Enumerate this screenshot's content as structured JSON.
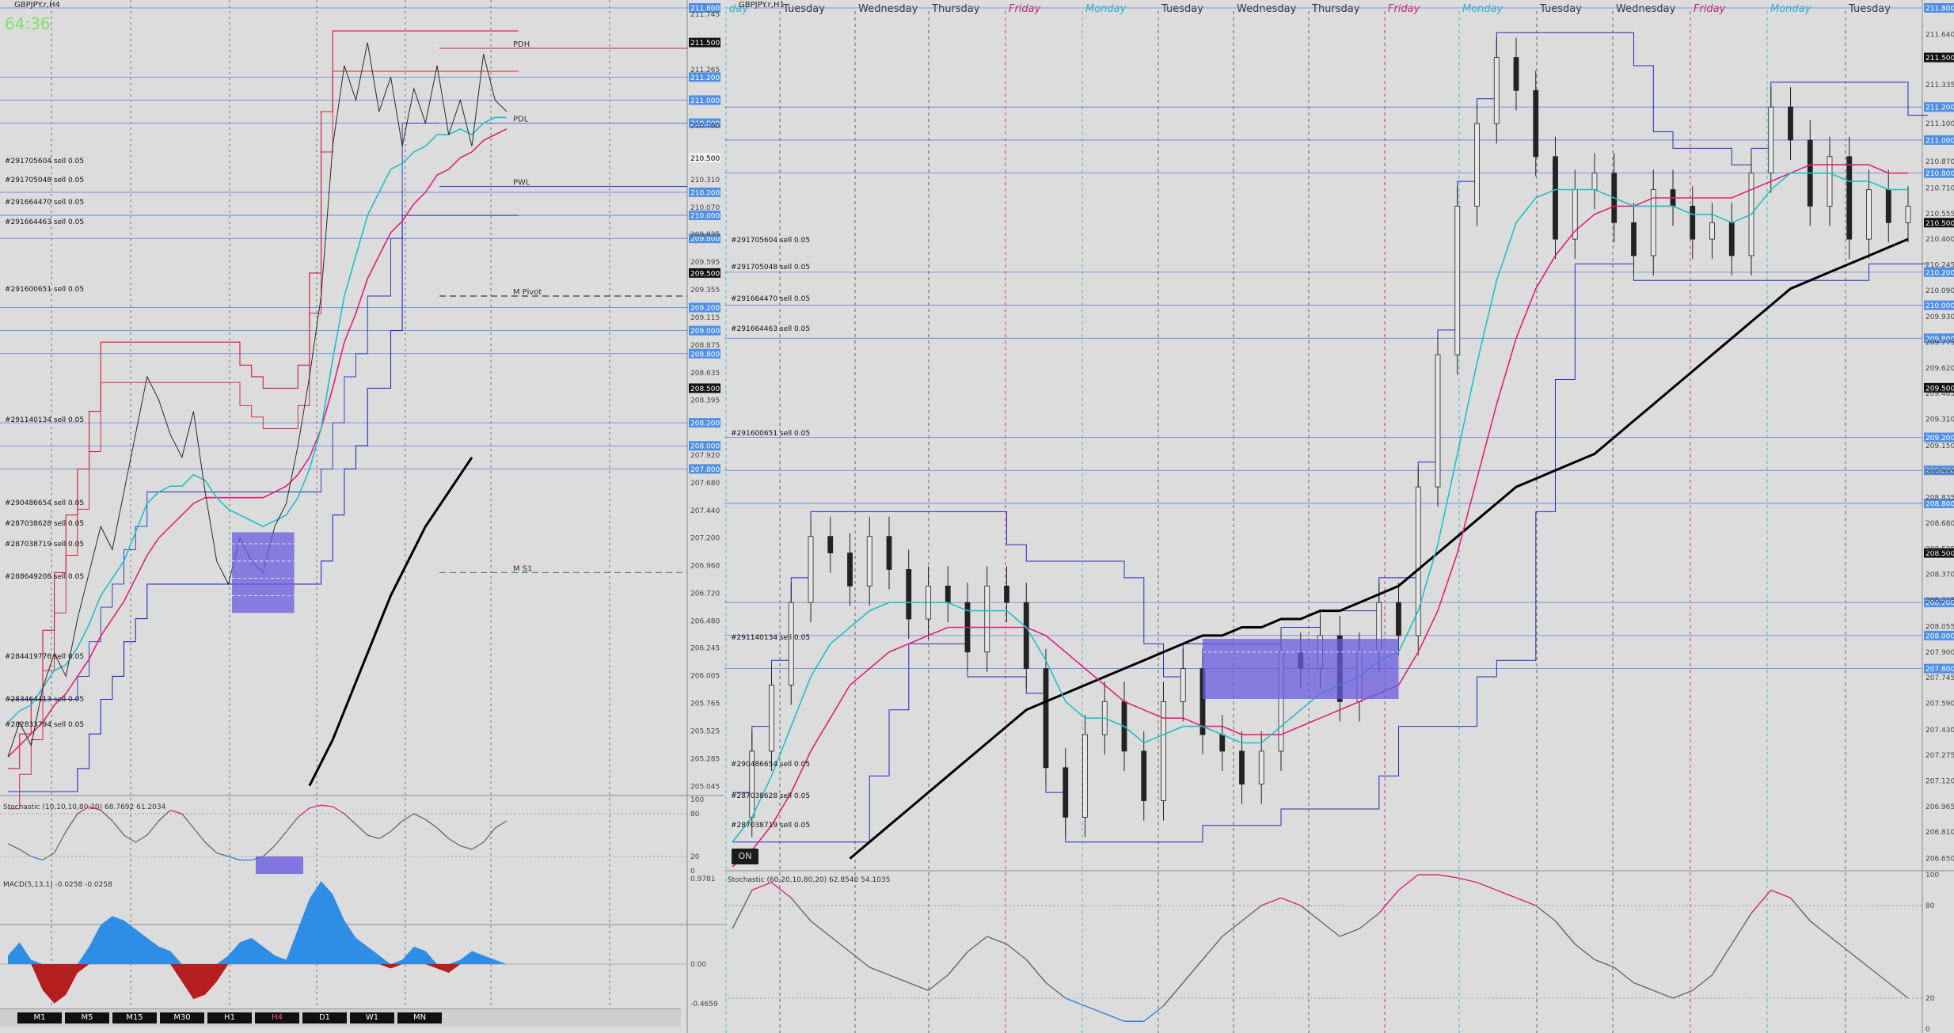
{
  "left": {
    "title": "GBPJPY.r,H4",
    "countdown": "64:36",
    "level_labels": {
      "pdh": "PDH",
      "pdl": "PDL",
      "pwl": "PWL",
      "m_pivot": "M Pivot",
      "m_s1": "M S1"
    },
    "price_ticks": [
      "211.745",
      "211.265",
      "210.780",
      "210.310",
      "210.070",
      "209.835",
      "209.595",
      "209.355",
      "209.115",
      "208.875",
      "208.635",
      "208.395",
      "207.920",
      "207.680",
      "207.440",
      "207.200",
      "206.960",
      "206.720",
      "206.480",
      "206.245",
      "206.005",
      "205.765",
      "205.525",
      "205.285",
      "205.045"
    ],
    "price_tags": [
      {
        "text": "211.800",
        "kind": "blue"
      },
      {
        "text": "211.500",
        "kind": "black"
      },
      {
        "text": "211.200",
        "kind": "blue"
      },
      {
        "text": "211.000",
        "kind": "blue"
      },
      {
        "text": "210.800",
        "kind": "blue"
      },
      {
        "text": "210.500",
        "kind": "white"
      },
      {
        "text": "210.200",
        "kind": "blue"
      },
      {
        "text": "210.000",
        "kind": "blue"
      },
      {
        "text": "209.800",
        "kind": "blue"
      },
      {
        "text": "209.500",
        "kind": "black"
      },
      {
        "text": "209.200",
        "kind": "blue"
      },
      {
        "text": "209.000",
        "kind": "blue"
      },
      {
        "text": "208.800",
        "kind": "blue"
      },
      {
        "text": "208.500",
        "kind": "black"
      },
      {
        "text": "208.200",
        "kind": "blue"
      },
      {
        "text": "208.000",
        "kind": "blue"
      },
      {
        "text": "207.800",
        "kind": "blue"
      }
    ],
    "orders": [
      "#291705604 sell 0.05",
      "#291705048 sell 0.05",
      "#291664470 sell 0.05",
      "#291664463 sell 0.05",
      "#291600651 sell 0.05",
      "#291140134 sell 0.05",
      "#290486654 sell 0.05",
      "#287038628 sell 0.05",
      "#287038719 sell 0.05",
      "#288649208 sell 0.05",
      "#284419776 sell 0.05",
      "#283464413 sell 0.05",
      "#282833794 sell 0.05"
    ],
    "stochastic": {
      "label": "Stochastic (10,10,10,80,20) 68.7692 61.2034",
      "levels": [
        "100",
        "80",
        "20",
        "0"
      ]
    },
    "macd": {
      "label": "MACD(5,13,1) -0.0258 -0.0258",
      "levels": [
        "0.9781",
        "0.00",
        "-0.4659"
      ]
    },
    "timeframes": [
      "M1",
      "M5",
      "M15",
      "M30",
      "H1",
      "H4",
      "D1",
      "W1",
      "MN"
    ],
    "active_timeframe": "H4"
  },
  "right": {
    "title": "GBPJPY.r,H1",
    "day_labels": [
      {
        "text": "day",
        "color": "#27b5c9"
      },
      {
        "text": "Tuesday",
        "color": "#333333"
      },
      {
        "text": "Wednesday",
        "color": "#333333"
      },
      {
        "text": "Thursday",
        "color": "#333333"
      },
      {
        "text": "Friday",
        "color": "#d0216e"
      },
      {
        "text": "Monday",
        "color": "#27b5c9"
      },
      {
        "text": "Tuesday",
        "color": "#333333"
      },
      {
        "text": "Wednesday",
        "color": "#333333"
      },
      {
        "text": "Thursday",
        "color": "#333333"
      },
      {
        "text": "Friday",
        "color": "#d0216e"
      },
      {
        "text": "Monday",
        "color": "#27b5c9"
      },
      {
        "text": "Tuesday",
        "color": "#333333"
      },
      {
        "text": "Wednesday",
        "color": "#333333"
      },
      {
        "text": "Friday",
        "color": "#d0216e"
      },
      {
        "text": "Monday",
        "color": "#27b5c9"
      },
      {
        "text": "Tuesday",
        "color": "#333333"
      }
    ],
    "price_ticks": [
      "211.640",
      "211.335",
      "211.100",
      "210.870",
      "210.710",
      "210.555",
      "210.400",
      "210.245",
      "210.090",
      "209.930",
      "209.775",
      "209.620",
      "209.465",
      "209.310",
      "209.150",
      "208.995",
      "208.835",
      "208.680",
      "208.525",
      "208.370",
      "208.215",
      "208.055",
      "207.900",
      "207.745",
      "207.590",
      "207.430",
      "207.275",
      "207.120",
      "206.965",
      "206.810",
      "206.650"
    ],
    "price_tags": [
      {
        "text": "211.800",
        "kind": "blue"
      },
      {
        "text": "211.500",
        "kind": "black"
      },
      {
        "text": "211.200",
        "kind": "blue"
      },
      {
        "text": "211.000",
        "kind": "blue"
      },
      {
        "text": "210.800",
        "kind": "blue"
      },
      {
        "text": "210.500",
        "kind": "black"
      },
      {
        "text": "210.200",
        "kind": "blue"
      },
      {
        "text": "210.000",
        "kind": "blue"
      },
      {
        "text": "209.800",
        "kind": "blue"
      },
      {
        "text": "209.500",
        "kind": "black"
      },
      {
        "text": "209.200",
        "kind": "blue"
      },
      {
        "text": "209.000",
        "kind": "blue"
      },
      {
        "text": "208.800",
        "kind": "blue"
      },
      {
        "text": "208.500",
        "kind": "black"
      },
      {
        "text": "208.200",
        "kind": "blue"
      },
      {
        "text": "208.000",
        "kind": "blue"
      },
      {
        "text": "207.800",
        "kind": "blue"
      }
    ],
    "orders": [
      "#291705604 sell 0.05",
      "#291705048 sell 0.05",
      "#291664470 sell 0.05",
      "#291664463 sell 0.05",
      "#291600651 sell 0.05",
      "#291140134 sell 0.05",
      "#290486654 sell 0.05",
      "#287038628 sell 0.05",
      "#287038719 sell 0.05"
    ],
    "on_badge": "ON",
    "stochastic": {
      "label": "Stochastic (60,20,10,80,20) 62.8540 54.1035",
      "levels": [
        "100",
        "80",
        "20",
        "0"
      ]
    }
  },
  "chart_data": [
    {
      "type": "line",
      "symbol": "GBPJPY.r",
      "timeframe": "H4",
      "ylim": [
        205.0,
        211.8
      ],
      "close": [
        205.3,
        205.6,
        205.4,
        205.9,
        206.2,
        206.0,
        206.5,
        206.9,
        207.3,
        207.1,
        207.6,
        208.1,
        208.6,
        208.4,
        208.1,
        207.9,
        208.3,
        207.6,
        207.0,
        206.8,
        207.2,
        207.0,
        206.9,
        207.3,
        207.5,
        208.0,
        208.6,
        209.3,
        210.6,
        211.3,
        211.0,
        211.5,
        210.9,
        211.2,
        210.6,
        211.1,
        210.8,
        211.3,
        210.7,
        211.0,
        210.6,
        211.4,
        211.0,
        210.9
      ],
      "ema_cyan": [
        205.6,
        205.7,
        205.75,
        205.9,
        206.05,
        206.1,
        206.25,
        206.45,
        206.7,
        206.85,
        207.0,
        207.25,
        207.5,
        207.6,
        207.65,
        207.65,
        207.75,
        207.7,
        207.55,
        207.45,
        207.4,
        207.35,
        207.3,
        207.35,
        207.4,
        207.55,
        207.8,
        208.15,
        208.75,
        209.3,
        209.65,
        210.0,
        210.2,
        210.4,
        210.45,
        210.55,
        210.6,
        210.7,
        210.7,
        210.75,
        210.7,
        210.8,
        210.85,
        210.85
      ],
      "ema_magenta": [
        205.3,
        205.4,
        205.5,
        205.6,
        205.75,
        205.85,
        206.0,
        206.15,
        206.35,
        206.5,
        206.65,
        206.85,
        207.05,
        207.2,
        207.3,
        207.4,
        207.5,
        207.55,
        207.55,
        207.55,
        207.55,
        207.55,
        207.55,
        207.6,
        207.65,
        207.75,
        207.9,
        208.15,
        208.5,
        208.9,
        209.15,
        209.45,
        209.65,
        209.85,
        209.95,
        210.1,
        210.2,
        210.35,
        210.4,
        210.5,
        210.55,
        210.65,
        210.7,
        210.75
      ],
      "sma_black": [
        null,
        null,
        null,
        null,
        null,
        null,
        null,
        null,
        null,
        null,
        null,
        null,
        null,
        null,
        null,
        null,
        null,
        null,
        null,
        null,
        null,
        null,
        null,
        null,
        null,
        null,
        205.05,
        205.25,
        205.45,
        205.7,
        205.95,
        206.2,
        206.45,
        206.7,
        206.9,
        207.1,
        207.3,
        207.45,
        207.6,
        207.75,
        207.9,
        null,
        null,
        null
      ],
      "donchian_upper": [
        205.2,
        205.5,
        205.8,
        206.4,
        206.9,
        207.4,
        207.8,
        208.3,
        208.9,
        208.9,
        208.9,
        208.9,
        208.9,
        208.9,
        208.9,
        208.9,
        208.9,
        208.9,
        208.9,
        208.9,
        208.7,
        208.6,
        208.5,
        208.5,
        208.5,
        208.7,
        209.5,
        210.9,
        211.6,
        211.6,
        211.6,
        211.6,
        211.6,
        211.6,
        211.6,
        211.6,
        211.6,
        211.6,
        211.6,
        211.6,
        211.6,
        211.6,
        211.6,
        211.6
      ],
      "donchian_lower": [
        205.0,
        205.0,
        205.0,
        205.0,
        205.0,
        205.0,
        205.2,
        205.5,
        205.8,
        206.0,
        206.3,
        206.5,
        206.8,
        206.8,
        206.8,
        206.8,
        206.8,
        206.8,
        206.8,
        206.8,
        206.8,
        206.8,
        206.8,
        206.8,
        206.8,
        206.8,
        206.8,
        207.0,
        207.4,
        207.8,
        208.0,
        208.5,
        208.5,
        209.0,
        210.0,
        210.0,
        210.0,
        210.0,
        210.0,
        210.0,
        210.0,
        210.0,
        210.0,
        210.0
      ],
      "levels": {
        "PDH": 211.45,
        "PDL": 210.8,
        "PWL": 210.25,
        "M Pivot": 209.3,
        "M S1": 206.9
      },
      "stochastic_main": [
        38,
        30,
        20,
        15,
        25,
        55,
        80,
        90,
        85,
        70,
        50,
        40,
        50,
        70,
        85,
        80,
        60,
        40,
        25,
        20,
        15,
        15,
        20,
        35,
        55,
        75,
        88,
        92,
        90,
        80,
        65,
        50,
        45,
        55,
        70,
        80,
        72,
        60,
        45,
        35,
        30,
        40,
        60,
        70
      ],
      "macd_hist": [
        0.1,
        0.25,
        0.05,
        -0.3,
        -0.45,
        -0.35,
        -0.1,
        0.2,
        0.45,
        0.55,
        0.5,
        0.4,
        0.3,
        0.2,
        0.15,
        -0.2,
        -0.4,
        -0.35,
        -0.2,
        0.1,
        0.25,
        0.3,
        0.2,
        0.1,
        0.05,
        0.4,
        0.75,
        0.95,
        0.8,
        0.5,
        0.3,
        0.2,
        0.1,
        -0.05,
        0.05,
        0.2,
        0.15,
        -0.05,
        -0.1,
        0.05,
        0.15,
        0.1,
        0.05,
        0.0
      ]
    },
    {
      "type": "line",
      "symbol": "GBPJPY.r",
      "timeframe": "H1",
      "ylim": [
        206.6,
        211.8
      ],
      "close": [
        206.9,
        207.3,
        207.7,
        208.2,
        208.6,
        208.5,
        208.3,
        208.6,
        208.4,
        208.1,
        208.3,
        208.2,
        207.9,
        208.3,
        208.2,
        207.8,
        207.2,
        206.9,
        207.4,
        207.6,
        207.3,
        207.0,
        207.6,
        207.8,
        207.4,
        207.3,
        207.1,
        207.3,
        207.9,
        207.8,
        208.0,
        207.6,
        207.9,
        208.2,
        208.0,
        208.9,
        209.7,
        210.6,
        211.1,
        211.5,
        211.3,
        210.9,
        210.4,
        210.7,
        210.8,
        210.5,
        210.3,
        210.7,
        210.6,
        210.4,
        210.5,
        210.3,
        210.8,
        211.2,
        211.0,
        210.6,
        210.9,
        210.4,
        210.7,
        210.5,
        210.6
      ],
      "ema_cyan": [
        206.75,
        206.9,
        207.15,
        207.45,
        207.75,
        207.95,
        208.05,
        208.15,
        208.2,
        208.2,
        208.2,
        208.2,
        208.15,
        208.15,
        208.15,
        208.05,
        207.85,
        207.6,
        207.5,
        207.5,
        207.45,
        207.35,
        207.4,
        207.45,
        207.45,
        207.4,
        207.35,
        207.35,
        207.45,
        207.55,
        207.65,
        207.7,
        207.75,
        207.85,
        207.9,
        208.15,
        208.55,
        209.1,
        209.65,
        210.15,
        210.5,
        210.65,
        210.7,
        210.7,
        210.7,
        210.65,
        210.6,
        210.6,
        210.6,
        210.55,
        210.55,
        210.5,
        210.55,
        210.7,
        210.8,
        210.8,
        210.8,
        210.75,
        210.75,
        210.7,
        210.7
      ],
      "ema_magenta": [
        206.6,
        206.7,
        206.85,
        207.05,
        207.3,
        207.5,
        207.7,
        207.8,
        207.9,
        207.95,
        208.0,
        208.05,
        208.05,
        208.05,
        208.05,
        208.05,
        208.0,
        207.9,
        207.8,
        207.7,
        207.6,
        207.55,
        207.5,
        207.5,
        207.45,
        207.45,
        207.4,
        207.4,
        207.4,
        207.45,
        207.5,
        207.55,
        207.6,
        207.65,
        207.7,
        207.9,
        208.15,
        208.5,
        208.95,
        209.4,
        209.8,
        210.1,
        210.3,
        210.45,
        210.55,
        210.6,
        210.6,
        210.65,
        210.65,
        210.65,
        210.65,
        210.65,
        210.7,
        210.75,
        210.8,
        210.85,
        210.85,
        210.85,
        210.85,
        210.8,
        210.8
      ],
      "sma_black": [
        null,
        null,
        null,
        null,
        null,
        null,
        206.65,
        206.75,
        206.85,
        206.95,
        207.05,
        207.15,
        207.25,
        207.35,
        207.45,
        207.55,
        207.6,
        207.65,
        207.7,
        207.75,
        207.8,
        207.85,
        207.9,
        207.95,
        208.0,
        208.0,
        208.05,
        208.05,
        208.1,
        208.1,
        208.15,
        208.15,
        208.2,
        208.25,
        208.3,
        208.4,
        208.5,
        208.6,
        208.7,
        208.8,
        208.9,
        208.95,
        209.0,
        209.05,
        209.1,
        209.2,
        209.3,
        209.4,
        209.5,
        209.6,
        209.7,
        209.8,
        209.9,
        210.0,
        210.1,
        210.15,
        210.2,
        210.25,
        210.3,
        210.35,
        210.4
      ],
      "stochastic_main": [
        65,
        90,
        95,
        85,
        70,
        60,
        50,
        40,
        35,
        30,
        25,
        35,
        50,
        60,
        55,
        45,
        30,
        20,
        15,
        10,
        5,
        5,
        15,
        30,
        45,
        60,
        70,
        80,
        85,
        80,
        70,
        60,
        65,
        75,
        90,
        100,
        100,
        98,
        95,
        90,
        85,
        80,
        70,
        55,
        45,
        40,
        30,
        25,
        20,
        25,
        35,
        55,
        75,
        90,
        85,
        70,
        60,
        50,
        40,
        30,
        20
      ],
      "stochastic_signal": [
        60,
        80,
        90,
        88,
        78,
        68,
        58,
        48,
        40,
        35,
        30,
        32,
        42,
        52,
        55,
        50,
        38,
        28,
        20,
        15,
        10,
        8,
        12,
        22,
        35,
        50,
        62,
        72,
        80,
        82,
        76,
        68,
        65,
        70,
        82,
        95,
        99,
        98,
        96,
        92,
        87,
        82,
        75,
        62,
        52,
        45,
        38,
        30,
        24,
        24,
        30,
        45,
        62,
        80,
        85,
        78,
        68,
        58,
        48,
        38,
        28
      ]
    }
  ]
}
